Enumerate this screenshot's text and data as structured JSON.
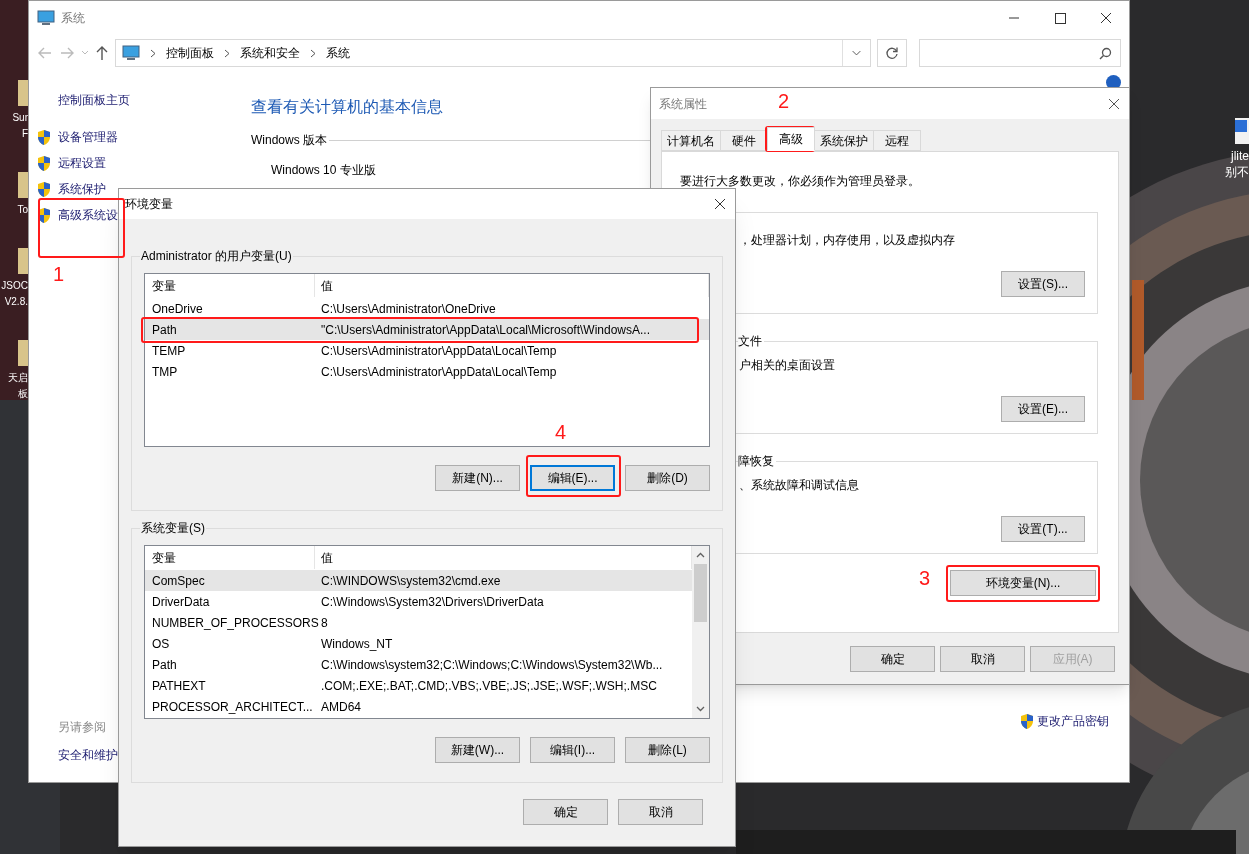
{
  "desktop": {
    "left_icons": [
      {
        "lines": [
          "Sur",
          "F"
        ]
      },
      {
        "lines": [
          "To"
        ]
      },
      {
        "lines": [
          "JSOC",
          "V2.8."
        ]
      },
      {
        "lines": [
          "天启",
          "板"
        ]
      }
    ],
    "right_icons": [
      {
        "lines": [
          "jlite",
          "别不"
        ]
      }
    ]
  },
  "system_window": {
    "title": "系统",
    "breadcrumbs": [
      "控制面板",
      "系统和安全",
      "系统"
    ],
    "sidebar": {
      "home": "控制面板主页",
      "items": [
        {
          "label": "设备管理器"
        },
        {
          "label": "远程设置"
        },
        {
          "label": "系统保护"
        },
        {
          "label": "高级系统设"
        }
      ],
      "see_also": "另请参阅",
      "see_also_items": [
        "安全和维护"
      ]
    },
    "heading": "查看有关计算机的基本信息",
    "section": "Windows 版本",
    "edition": "Windows 10 专业版",
    "product_key_link": "更改产品密钥"
  },
  "system_properties": {
    "title": "系统属性",
    "tabs": [
      {
        "label": "计算机名",
        "selected": false
      },
      {
        "label": "硬件",
        "selected": false
      },
      {
        "label": "高级",
        "selected": true
      },
      {
        "label": "系统保护",
        "selected": false
      },
      {
        "label": "远程",
        "selected": false
      }
    ],
    "notice": "要进行大多数更改，你必须作为管理员登录。",
    "groups": [
      {
        "description": "，处理器计划，内存使用，以及虚拟内存",
        "button": "设置(S)..."
      },
      {
        "title": "文件",
        "description": "户相关的桌面设置",
        "button": "设置(E)..."
      },
      {
        "title": "障恢复",
        "description": "、系统故障和调试信息",
        "button": "设置(T)..."
      }
    ],
    "env_button": "环境变量(N)...",
    "buttons": [
      {
        "label": "确定",
        "disabled": false
      },
      {
        "label": "取消",
        "disabled": false
      },
      {
        "label": "应用(A)",
        "disabled": true
      }
    ]
  },
  "env_dialog": {
    "title": "环境变量",
    "user_vars": {
      "title": "Administrator 的用户变量(U)",
      "columns": [
        "变量",
        "值"
      ],
      "rows": [
        {
          "name": "OneDrive",
          "value": "C:\\Users\\Administrator\\OneDrive",
          "selected": false
        },
        {
          "name": "Path",
          "value": "\"C:\\Users\\Administrator\\AppData\\Local\\Microsoft\\WindowsA...",
          "selected": true
        },
        {
          "name": "TEMP",
          "value": "C:\\Users\\Administrator\\AppData\\Local\\Temp",
          "selected": false
        },
        {
          "name": "TMP",
          "value": "C:\\Users\\Administrator\\AppData\\Local\\Temp",
          "selected": false
        }
      ],
      "buttons": [
        {
          "label": "新建(N)...",
          "focused": false
        },
        {
          "label": "编辑(E)...",
          "focused": true
        },
        {
          "label": "删除(D)",
          "focused": false
        }
      ]
    },
    "system_vars": {
      "title": "系统变量(S)",
      "columns": [
        "变量",
        "值"
      ],
      "rows": [
        {
          "name": "ComSpec",
          "value": "C:\\WINDOWS\\system32\\cmd.exe",
          "selected": true
        },
        {
          "name": "DriverData",
          "value": "C:\\Windows\\System32\\Drivers\\DriverData",
          "selected": false
        },
        {
          "name": "NUMBER_OF_PROCESSORS",
          "value": "8",
          "selected": false
        },
        {
          "name": "OS",
          "value": "Windows_NT",
          "selected": false
        },
        {
          "name": "Path",
          "value": "C:\\Windows\\system32;C:\\Windows;C:\\Windows\\System32\\Wb...",
          "selected": false
        },
        {
          "name": "PATHEXT",
          "value": ".COM;.EXE;.BAT;.CMD;.VBS;.VBE;.JS;.JSE;.WSF;.WSH;.MSC",
          "selected": false
        },
        {
          "name": "PROCESSOR_ARCHITECT...",
          "value": "AMD64",
          "selected": false
        }
      ],
      "buttons": [
        {
          "label": "新建(W)...",
          "focused": false
        },
        {
          "label": "编辑(I)...",
          "focused": false
        },
        {
          "label": "删除(L)",
          "focused": false
        }
      ]
    },
    "buttons": [
      "确定",
      "取消"
    ]
  },
  "annotations": [
    {
      "label": "1"
    },
    {
      "label": "2"
    },
    {
      "label": "3"
    },
    {
      "label": "4"
    }
  ]
}
